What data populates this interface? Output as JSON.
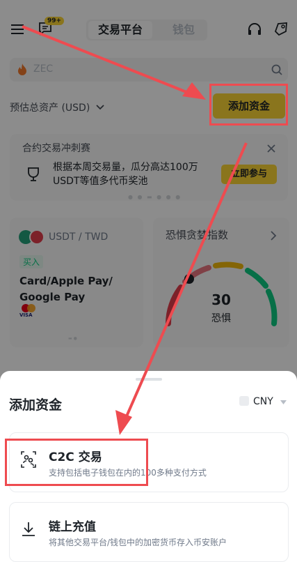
{
  "header": {
    "badge": "99+",
    "tabs": [
      {
        "label": "交易平台",
        "active": true
      },
      {
        "label": "钱包",
        "active": false
      }
    ]
  },
  "search": {
    "placeholder": "ZEC"
  },
  "balance": {
    "label": "预估总资产 (USD)",
    "add_funds_button": "添加资金"
  },
  "promo": {
    "title": "合约交易冲刺赛",
    "text": "根据本周交易量，瓜分高达100万USDT等值多代币奖池",
    "cta": "立即参与"
  },
  "c2c_card": {
    "pair": "USDT / TWD",
    "tag": "买入",
    "payment": "Card/Apple Pay/ Google Pay",
    "visa": "VISA"
  },
  "fear_greed": {
    "title": "恐惧贪婪指数",
    "value": "30",
    "label": "恐惧"
  },
  "sheet": {
    "title": "添加资金",
    "currency": "CNY",
    "options": [
      {
        "title": "C2C 交易",
        "desc": "支持包括电子钱包在内的100多种支付方式"
      },
      {
        "title": "链上充值",
        "desc": "将其他交易平台/钱包中的加密货币存入币安账户"
      }
    ]
  },
  "colors": {
    "accent": "#fcd535",
    "annotation": "#ee4b50",
    "buy": "#0ecb81"
  }
}
